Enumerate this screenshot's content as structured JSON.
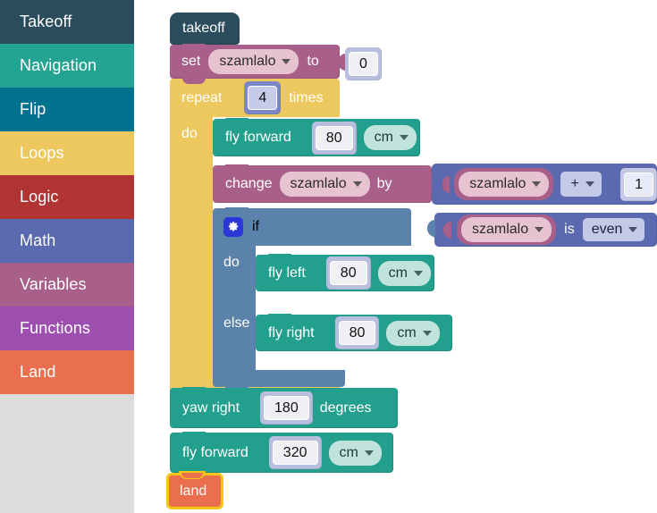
{
  "toolbox": {
    "items": [
      {
        "label": "Takeoff",
        "color": "#2b4c5c"
      },
      {
        "label": "Navigation",
        "color": "#23a391"
      },
      {
        "label": "Flip",
        "color": "#00718f"
      },
      {
        "label": "Loops",
        "color": "#edc85f"
      },
      {
        "label": "Logic",
        "color": "#b03434"
      },
      {
        "label": "Math",
        "color": "#5a6ab0"
      },
      {
        "label": "Variables",
        "color": "#a8608a"
      },
      {
        "label": "Functions",
        "color": "#9c4fae"
      },
      {
        "label": "Land",
        "color": "#ea6f4e"
      }
    ],
    "background": "#dcdcdc"
  },
  "workspace": {
    "colors": {
      "takeoff": "#2b4c5c",
      "variables": "#a8608a",
      "loops": "#edc85f",
      "navigation": "#22a08d",
      "math": "#5b6ab0",
      "logic": "#5a82ab",
      "land": "#ea6f4e",
      "selection": "#f5c518"
    },
    "blocks": {
      "takeoff": {
        "label": "takeoff"
      },
      "set_var": {
        "keyword": "set",
        "variable": "szamlalo",
        "to": "to",
        "value": "0"
      },
      "repeat": {
        "keyword": "repeat",
        "times": "times",
        "count": "4",
        "do": "do"
      },
      "fly_forward_1": {
        "label": "fly forward",
        "value": "80",
        "unit": "cm"
      },
      "change_var": {
        "keyword": "change",
        "variable": "szamlalo",
        "by": "by",
        "operand_left": "szamlalo",
        "operator": "+",
        "operand_right": "1"
      },
      "if_block": {
        "keyword": "if",
        "do": "do",
        "else": "else",
        "test_variable": "szamlalo",
        "test_is": "is",
        "test_value": "even",
        "gear_icon": "gear-icon"
      },
      "fly_left": {
        "label": "fly left",
        "value": "80",
        "unit": "cm"
      },
      "fly_right": {
        "label": "fly right",
        "value": "80",
        "unit": "cm"
      },
      "yaw_right": {
        "label": "yaw right",
        "value": "180",
        "unit": "degrees"
      },
      "fly_forward_2": {
        "label": "fly forward",
        "value": "320",
        "unit": "cm"
      },
      "land": {
        "label": "land",
        "selected": true
      }
    }
  }
}
